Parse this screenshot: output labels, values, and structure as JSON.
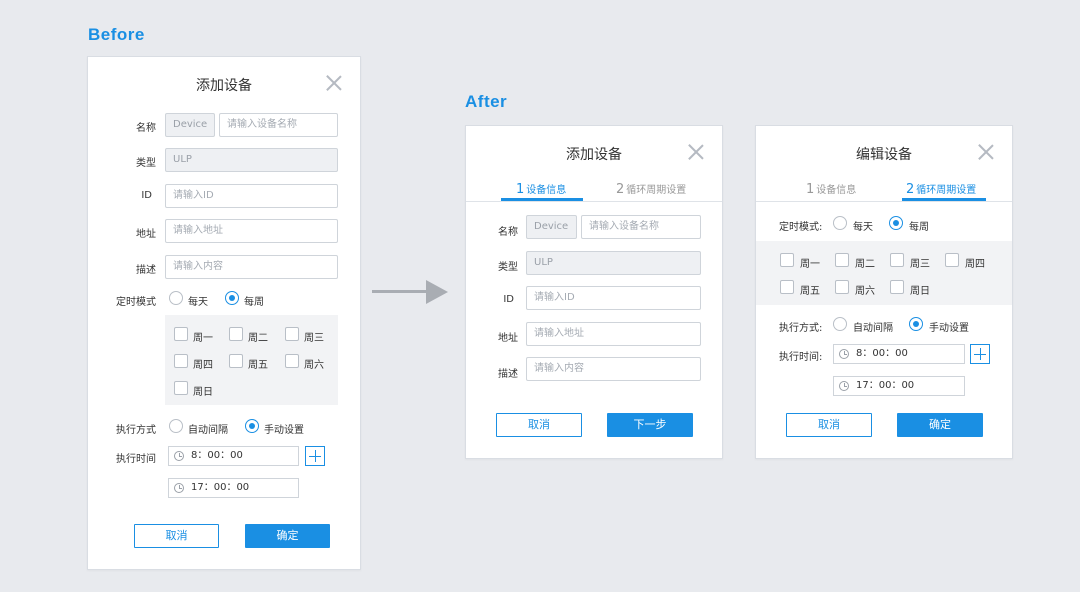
{
  "labels": {
    "before": "Before",
    "after": "After"
  },
  "before": {
    "title": "添加设备",
    "name_label": "名称",
    "name_prefix": "Device",
    "name_placeholder": "请输入设备名称",
    "type_label": "类型",
    "type_value": "ULP",
    "id_label": "ID",
    "id_placeholder": "请输入ID",
    "addr_label": "地址",
    "addr_placeholder": "请输入地址",
    "desc_label": "描述",
    "desc_placeholder": "请输入内容",
    "timer_label": "定时模式",
    "timer_options": [
      "每天",
      "每周"
    ],
    "timer_selected": "每周",
    "weekdays": [
      "周一",
      "周二",
      "周三",
      "周四",
      "周五",
      "周六",
      "周日"
    ],
    "exec_label": "执行方式",
    "exec_options": [
      "自动间隔",
      "手动设置"
    ],
    "exec_selected": "手动设置",
    "exec_time_label": "执行时间",
    "times": [
      "8：00：00",
      "17：00：00"
    ],
    "cancel": "取消",
    "confirm": "确定"
  },
  "after1": {
    "title": "添加设备",
    "tabs": [
      {
        "num": "1",
        "label": "设备信息",
        "active": true
      },
      {
        "num": "2",
        "label": "循环周期设置",
        "active": false
      }
    ],
    "name_label": "名称",
    "name_prefix": "Device",
    "name_placeholder": "请输入设备名称",
    "type_label": "类型",
    "type_value": "ULP",
    "id_label": "ID",
    "id_placeholder": "请输入ID",
    "addr_label": "地址",
    "addr_placeholder": "请输入地址",
    "desc_label": "描述",
    "desc_placeholder": "请输入内容",
    "cancel": "取消",
    "next": "下一步"
  },
  "after2": {
    "title": "编辑设备",
    "tabs": [
      {
        "num": "1",
        "label": "设备信息",
        "active": false
      },
      {
        "num": "2",
        "label": "循环周期设置",
        "active": true
      }
    ],
    "timer_label": "定时模式:",
    "timer_options": [
      "每天",
      "每周"
    ],
    "timer_selected": "每周",
    "weekdays": [
      "周一",
      "周二",
      "周三",
      "周四",
      "周五",
      "周六",
      "周日"
    ],
    "exec_label": "执行方式:",
    "exec_options": [
      "自动间隔",
      "手动设置"
    ],
    "exec_selected": "手动设置",
    "exec_time_label": "执行时间:",
    "times": [
      "8：00：00",
      "17：00：00"
    ],
    "cancel": "取消",
    "confirm": "确定"
  },
  "colors": {
    "accent": "#1a8fe3",
    "background": "#e8eaee",
    "arrow": "#a9adb3"
  }
}
